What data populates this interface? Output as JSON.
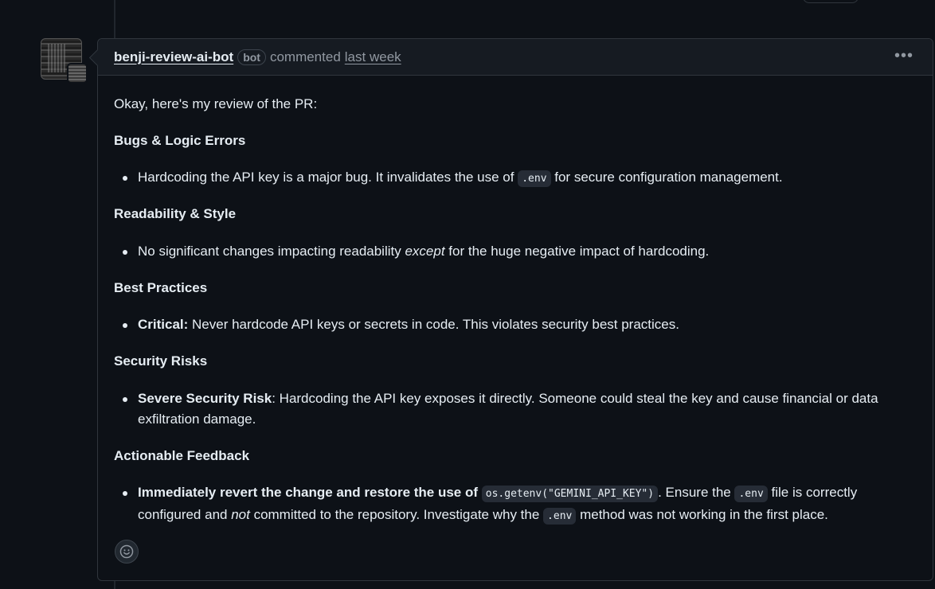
{
  "comment": {
    "author": "benji-review-ai-bot",
    "badge": "bot",
    "action": "commented",
    "time": "last week",
    "menu_icon": "kebab-horizontal-icon"
  },
  "body": {
    "intro": "Okay, here's my review of the PR:",
    "sections": [
      {
        "heading": "Bugs & Logic Errors"
      },
      {
        "heading": "Readability & Style"
      },
      {
        "heading": "Best Practices"
      },
      {
        "heading": "Security Risks"
      },
      {
        "heading": "Actionable Feedback"
      }
    ],
    "b1": {
      "pre": "Hardcoding the API key is a major bug. It invalidates the use of ",
      "code": ".env",
      "post": " for secure configuration management."
    },
    "b2": {
      "pre": "No significant changes impacting readability ",
      "em": "except",
      "post": " for the huge negative impact of hardcoding."
    },
    "b3": {
      "strong": "Critical:",
      "post": " Never hardcode API keys or secrets in code. This violates security best practices."
    },
    "b4": {
      "strong": "Severe Security Risk",
      "post": ": Hardcoding the API key exposes it directly. Someone could steal the key and cause financial or data exfiltration damage."
    },
    "b5": {
      "strong": "Immediately revert the change and restore the use of",
      "code1": "os.getenv(\"GEMINI_API_KEY\")",
      "t1": ". Ensure the ",
      "code2": ".env",
      "t2": " file is correctly configured and ",
      "em": "not",
      "t3": " committed to the repository. Investigate why the ",
      "code3": ".env",
      "t4": " method was not working in the first place."
    }
  },
  "reaction_icon": "smiley-icon"
}
